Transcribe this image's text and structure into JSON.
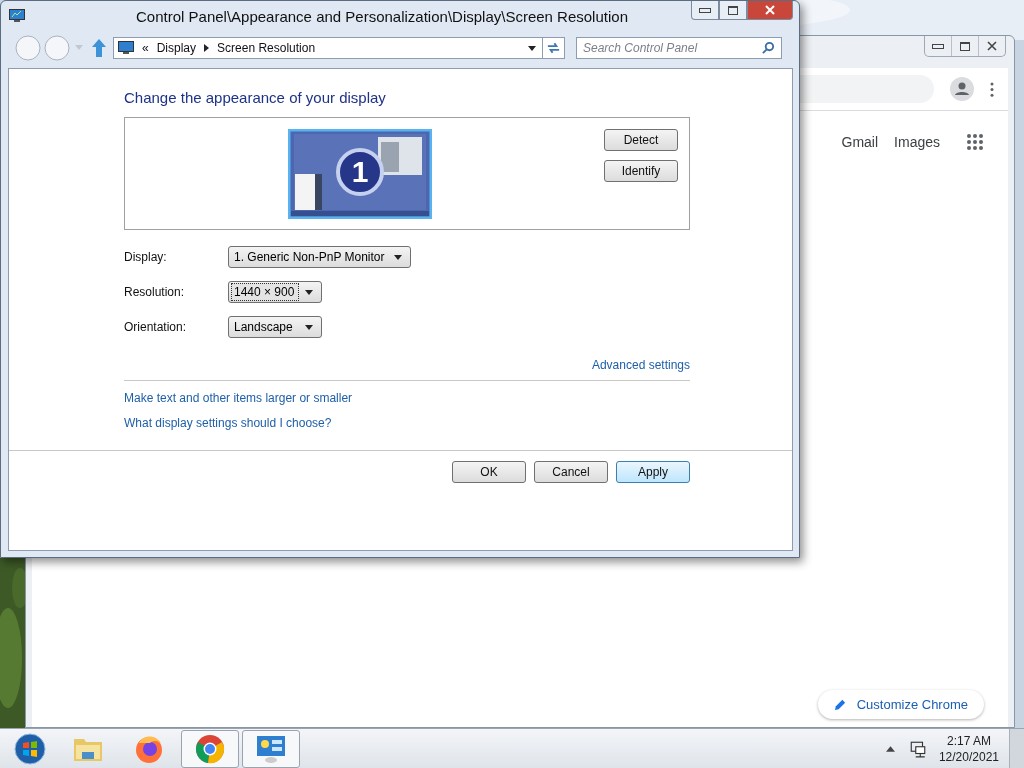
{
  "browser": {
    "links": [
      "Gmail",
      "Images"
    ],
    "customize": "Customize Chrome"
  },
  "dialog": {
    "title": "Control Panel\\Appearance and Personalization\\Display\\Screen Resolution",
    "nav_prefix": "«",
    "breadcrumb": [
      "Display",
      "Screen Resolution"
    ],
    "search": {
      "placeholder": "Search Control Panel"
    },
    "heading": "Change the appearance of your display",
    "display_number": "1",
    "side_buttons": [
      "Detect",
      "Identify"
    ],
    "fields": [
      {
        "label": "Display:",
        "value": "1. Generic Non-PnP Monitor",
        "focused": false
      },
      {
        "label": "Resolution:",
        "value": "1440 × 900",
        "focused": true
      },
      {
        "label": "Orientation:",
        "value": "Landscape",
        "focused": false
      }
    ],
    "advanced_link": "Advanced settings",
    "links": [
      "Make text and other items larger or smaller",
      "What display settings should I choose?"
    ],
    "buttons": [
      {
        "label": "OK",
        "hovered": false
      },
      {
        "label": "Cancel",
        "hovered": false
      },
      {
        "label": "Apply",
        "hovered": true
      }
    ]
  },
  "taskbar": {
    "apps": [
      {
        "kind": "start",
        "open": false
      },
      {
        "kind": "explorer",
        "open": false
      },
      {
        "kind": "firefox",
        "open": false
      },
      {
        "kind": "chrome",
        "open": true
      },
      {
        "kind": "control-panel",
        "open": true
      }
    ],
    "clock": {
      "time": "2:17 AM",
      "date": "12/20/2021"
    }
  }
}
